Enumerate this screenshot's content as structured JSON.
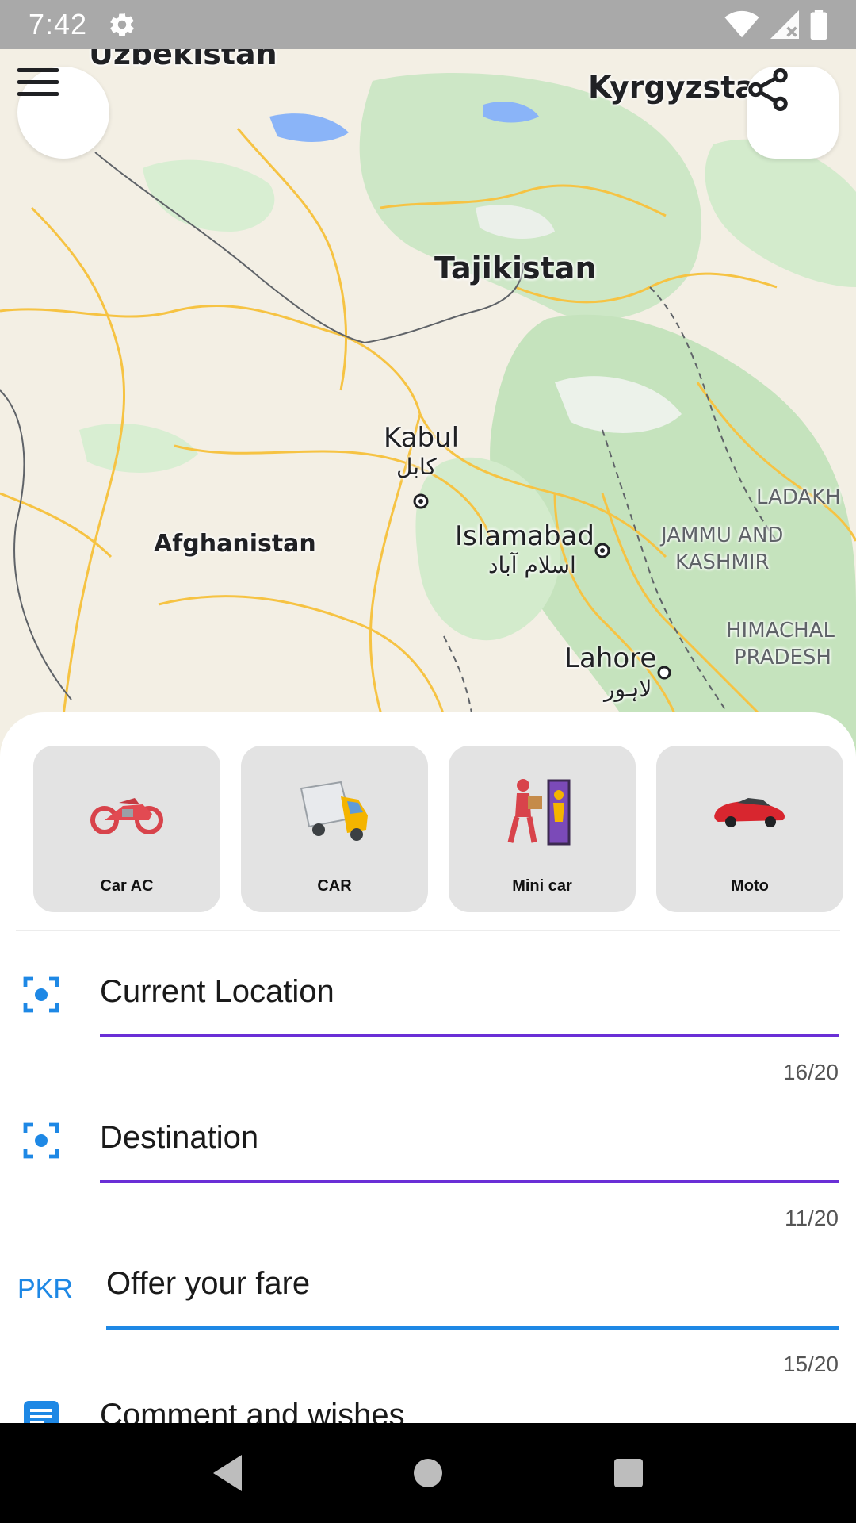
{
  "status_bar": {
    "time": "7:42"
  },
  "map": {
    "labels": {
      "uzbekistan": "Uzbekistan",
      "kyrgyzstan": "Kyrgyzstan",
      "tajikistan": "Tajikistan",
      "afghanistan": "Afghanistan",
      "kabul": "Kabul",
      "kabul_native": "کابل",
      "islamabad": "Islamabad",
      "islamabad_native": "اسلام آباد",
      "lahore": "Lahore",
      "lahore_native": "لاہور",
      "ladakh": "LADAKH",
      "jammu_kashmir_1": "JAMMU AND",
      "jammu_kashmir_2": "KASHMIR",
      "himachal_1": "HIMACHAL",
      "himachal_2": "PRADESH"
    },
    "colors": {
      "land": "#f3efe4",
      "green": "#c8e6c0",
      "road": "#f6c343",
      "water": "#8ab4f8"
    }
  },
  "toolbar": {
    "menu_icon": "menu-icon",
    "share_icon": "share-icon"
  },
  "vehicles": [
    {
      "label": "Car AC",
      "icon": "motorcycle-icon"
    },
    {
      "label": "CAR",
      "icon": "truck-icon"
    },
    {
      "label": "Mini car",
      "icon": "delivery-person-icon"
    },
    {
      "label": "Moto",
      "icon": "car-icon"
    }
  ],
  "form": {
    "current_location": {
      "value": "Current Location",
      "counter": "16/20"
    },
    "destination": {
      "value": "Destination",
      "counter": "11/20"
    },
    "fare": {
      "prefix": "PKR",
      "value": "Offer your fare",
      "counter": "15/20"
    },
    "comment": {
      "value": "Comment and wishes"
    }
  },
  "theme": {
    "accent_purple": "#6a2fd6",
    "accent_blue": "#1e88e5"
  }
}
